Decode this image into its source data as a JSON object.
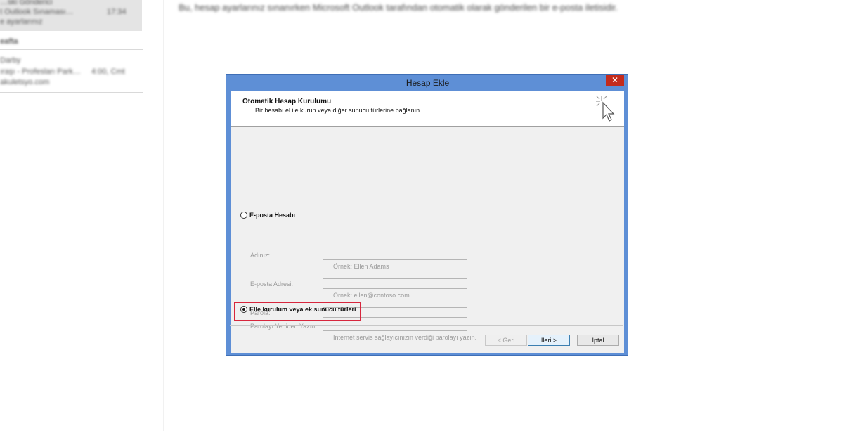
{
  "background": {
    "list_items": [
      {
        "line1": "…ski Gönderici",
        "line2": "t Outlook Sınaması…",
        "time": "17:34",
        "line3": "e ayarlarınız"
      },
      {
        "group": "eafta"
      },
      {
        "line1": "Darby",
        "line2": "ıraşı - Profesları Park…",
        "time": "4:00, Cmt",
        "line3": "akuletsyo.com"
      }
    ],
    "reading_text": "Bu, hesap ayarlarınız sınanırken Microsoft Outlook tarafından otomatik olarak gönderilen bir e-posta iletisidir."
  },
  "dialog": {
    "title": "Hesap Ekle",
    "close_glyph": "✕",
    "header_title": "Otomatik Hesap Kurulumu",
    "header_subtitle": "Bir hesabı el ile kurun veya diğer sunucu türlerine bağlanın.",
    "header_icon": "click-cursor-icon",
    "email_option": "E-posta Hesabı",
    "fields": {
      "name_label": "Adınız:",
      "name_hint": "Örnek: Ellen Adams",
      "email_label": "E-posta Adresi:",
      "email_hint": "Örnek: ellen@contoso.com",
      "password_label": "Parola:",
      "password_retype_label": "Parolayı Yeniden Yazın:",
      "password_hint": "Internet servis sağlayıcınızın verdiği parolayı yazın."
    },
    "manual_option": "Elle kurulum veya ek sunucu türleri",
    "manual_selected": true,
    "highlight_color": "#d7263d",
    "buttons": {
      "back": "< Geri",
      "next": "İleri >",
      "cancel": "İptal"
    }
  }
}
